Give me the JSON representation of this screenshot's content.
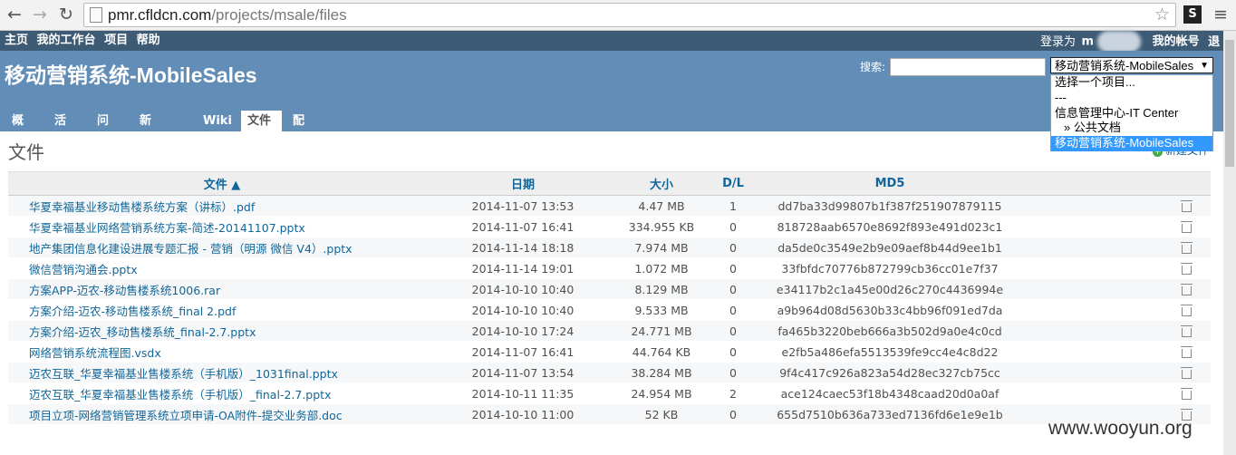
{
  "browser": {
    "back_icon": "←",
    "forward_icon": "→",
    "reload_icon": "↻",
    "url_host": "pmr.cfldcn.com",
    "url_path": "/projects/msale/files",
    "star_icon": "☆",
    "ext_label": "S",
    "menu_icon": "≡"
  },
  "topmenu": {
    "items": [
      "主页",
      "我的工作台",
      "项目",
      "帮助"
    ],
    "login_prefix": "登录为",
    "login_user": "m",
    "my_account": "我的帐号",
    "logout": "退出"
  },
  "header": {
    "title": "移动营销系统-MobileSales",
    "search_label": "搜索:",
    "project_select_value": "移动营销系统-MobileSales",
    "project_options": [
      "选择一个项目...",
      "---",
      "信息管理中心-IT Center",
      "» 公共文档",
      "移动营销系统-MobileSales"
    ]
  },
  "tabs": [
    "概述",
    "活动",
    "问题",
    "新建问题",
    "Wiki",
    "文件",
    "配置"
  ],
  "content": {
    "title": "文件",
    "new_file": "新建文件",
    "columns": [
      "文件 ▲",
      "日期",
      "大小",
      "D/L",
      "MD5"
    ],
    "files": [
      {
        "name": "华夏幸福基业移动售楼系统方案（讲标）.pdf",
        "date": "2014-11-07 13:53",
        "size": "4.47 MB",
        "dl": "1",
        "md5": "dd7ba33d99807b1f387f251907879115"
      },
      {
        "name": "华夏幸福基业网络营销系统方案-简述-20141107.pptx",
        "date": "2014-11-07 16:41",
        "size": "334.955 KB",
        "dl": "0",
        "md5": "818728aab6570e8692f893e491d023c1"
      },
      {
        "name": "地产集团信息化建设进展专题汇报 - 营销（明源 微信 V4）.pptx",
        "date": "2014-11-14 18:18",
        "size": "7.974 MB",
        "dl": "0",
        "md5": "da5de0c3549e2b9e09aef8b44d9ee1b1"
      },
      {
        "name": "微信营销沟通会.pptx",
        "date": "2014-11-14 19:01",
        "size": "1.072 MB",
        "dl": "0",
        "md5": "33fbfdc70776b872799cb36cc01e7f37"
      },
      {
        "name": "方案APP-迈农-移动售楼系统1006.rar",
        "date": "2014-10-10 10:40",
        "size": "8.129 MB",
        "dl": "0",
        "md5": "e34117b2c1a45e00d26c270c4436994e"
      },
      {
        "name": "方案介绍-迈农-移动售楼系统_final 2.pdf",
        "date": "2014-10-10 10:40",
        "size": "9.533 MB",
        "dl": "0",
        "md5": "a9b964d08d5630b33c4bb96f091ed7da"
      },
      {
        "name": "方案介绍-迈农_移动售楼系统_final-2.7.pptx",
        "date": "2014-10-10 17:24",
        "size": "24.771 MB",
        "dl": "0",
        "md5": "fa465b3220beb666a3b502d9a0e4c0cd"
      },
      {
        "name": "网络营销系统流程图.vsdx",
        "date": "2014-11-07 16:41",
        "size": "44.764 KB",
        "dl": "0",
        "md5": "e2fb5a486efa5513539fe9cc4e4c8d22"
      },
      {
        "name": "迈农互联_华夏幸福基业售楼系统（手机版）_1031final.pptx",
        "date": "2014-11-07 13:54",
        "size": "38.284 MB",
        "dl": "0",
        "md5": "9f4c417c926a823a54d28ec327cb75cc"
      },
      {
        "name": "迈农互联_华夏幸福基业售楼系统（手机版）_final-2.7.pptx",
        "date": "2014-10-11 11:35",
        "size": "24.954 MB",
        "dl": "2",
        "md5": "ace124caec53f18b4348caad20d0a0af"
      },
      {
        "name": "项目立项-网络营销管理系统立项申请-OA附件-提交业务部.doc",
        "date": "2014-10-10 11:00",
        "size": "52 KB",
        "dl": "0",
        "md5": "655d7510b636a733ed7136fd6e1e9e1b"
      }
    ]
  },
  "watermark": "www.wooyun.org",
  "colors": {
    "topmenu_bg": "#3e5b76",
    "header_bg": "#628db6",
    "link": "#169",
    "selected_option": "#3399ff"
  }
}
